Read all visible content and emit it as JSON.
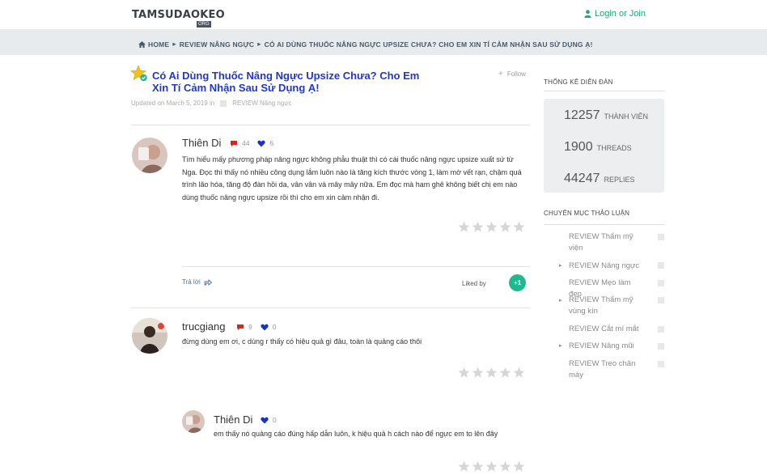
{
  "header": {
    "logo": "TAMSUDAOKEO",
    "logo_sub": "ORG",
    "login": "Login or Join"
  },
  "breadcrumb": [
    "HOME",
    "REVIEW NÂNG NGỰC",
    "CÓ AI DÙNG THUỐC NÂNG NGỰC UPSIZE CHƯA? CHO EM XIN TÍ CẢM NHẬN SAU SỬ DỤNG Ạ!"
  ],
  "thread": {
    "title": "Có Ai Dùng Thuốc Nâng Ngực Upsize Chưa? Cho Em Xin Tí Cảm Nhận Sau Sử Dụng Ạ!",
    "follow": "Follow",
    "updated": "Updated on March 5, 2019 in",
    "category": "REVIEW Nâng ngực"
  },
  "posts": [
    {
      "author": "Thiên Di",
      "comments": "44",
      "likes": "6",
      "body": "Tìm hiểu mấy phương pháp nâng ngực không phẫu thuật thì có cái thuốc nâng ngực upsize xuất sứ từ Nga. Đọc thì thấy nó nhiều công dụng lắm luôn nào là tăng kích thước vòng 1, làm mờ vết rạn, chậm quá trình lão hóa, tăng độ đàn hồi da, vân vân và mây mây nữa. Em đọc mà ham ghê không biết chị em nào dùng thuốc nâng ngực upsize rồi thì cho em xin cảm nhận đi.",
      "reply": "Trả lời",
      "liked_by": "Liked by",
      "liked_count": "+1"
    },
    {
      "author": "trucgiang",
      "comments": "9",
      "likes": "0",
      "body": "đừng dùng em ơi, c dùng r thấy có hiệu quả gì đâu, toàn là quảng cáo thôi"
    },
    {
      "author": "Thiên Di",
      "likes": "0",
      "body": "em thấy nó quảng cáo đúng hấp dẫn luôn, k hiệu quả h cách nào để ngực em to lên đây"
    }
  ],
  "sidebar": {
    "stats_heading": "THỐNG KÊ DIỄN ĐÀN",
    "stats": [
      {
        "num": "12257",
        "label": "THÀNH VIÊN"
      },
      {
        "num": "1900",
        "label": "THREADS"
      },
      {
        "num": "44247",
        "label": "REPLIES"
      }
    ],
    "forums_heading": "CHUYÊN MỤC THẢO LUẬN",
    "forums": [
      "REVIEW Thẩm mỹ viện",
      "REVIEW Nâng ngực",
      "REVIEW Mẹo làm đẹp",
      "REVIEW Thẩm mỹ vùng kín",
      "REVIEW Cắt mí mắt",
      "REVIEW Nâng mũi",
      "REVIEW Treo chân mày"
    ]
  },
  "colors": {
    "accent_green": "#1fa67a",
    "title_blue": "#2138c8",
    "comment_red": "#d9261c",
    "heart_blue": "#1b33c4"
  }
}
